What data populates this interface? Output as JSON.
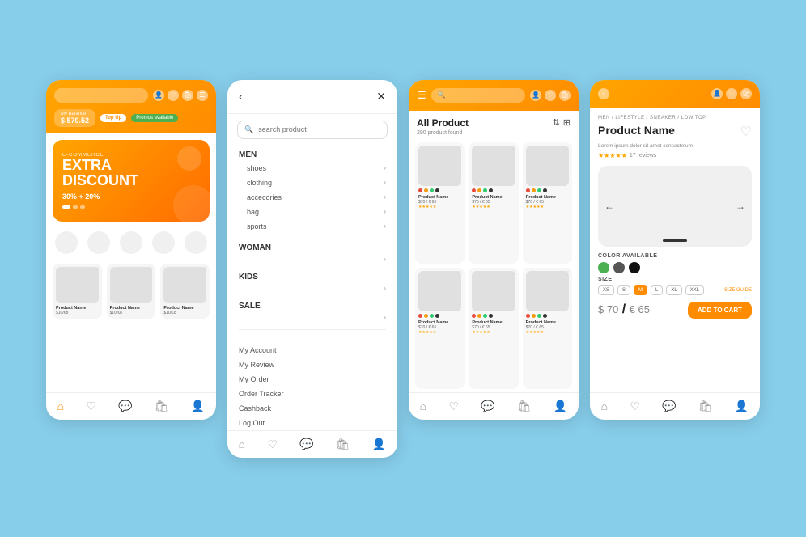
{
  "background": "#87CEEB",
  "screens": {
    "screen1": {
      "header": {
        "balance_label": "My Balance",
        "balance_amount": "$ 570.52",
        "top_up": "Top Up",
        "promo": "Promos available"
      },
      "banner": {
        "tag": "E-COMMERCE",
        "line1": "EXTRA",
        "line2": "DISCOUNT",
        "discount": "30% + 20%"
      },
      "products": [
        {
          "name": "Product Name",
          "price": "$10/€8"
        },
        {
          "name": "Product Name",
          "price": "$10/€8"
        },
        {
          "name": "Product Name",
          "price": "$10/€8"
        }
      ],
      "nav": [
        "🏠",
        "♡",
        "💬",
        "🛍",
        "👤"
      ]
    },
    "screen2": {
      "menu_sections": [
        {
          "title": "MEN",
          "items": [
            "shoes",
            "clothing",
            "accecories",
            "bag",
            "sports"
          ]
        },
        {
          "title": "WOMAN",
          "items": []
        },
        {
          "title": "KIDS",
          "items": []
        },
        {
          "title": "SALE",
          "items": []
        }
      ],
      "links": [
        "My Account",
        "My Review",
        "My Order",
        "Order Tracker",
        "Cashback",
        "Log Out"
      ],
      "search_placeholder": "search product"
    },
    "screen3": {
      "title": "All Product",
      "subtitle": "290 product found",
      "products": [
        {
          "name": "Product Name",
          "price": "$70 / € 65",
          "colors": [
            "#e74c3c",
            "#f39c12",
            "#2ecc71",
            "#333"
          ]
        },
        {
          "name": "Product Name",
          "price": "$70 / € 65",
          "colors": [
            "#e74c3c",
            "#f39c12",
            "#2ecc71",
            "#333"
          ]
        },
        {
          "name": "Product Name",
          "price": "$70 / € 65",
          "colors": [
            "#e74c3c",
            "#f39c12",
            "#2ecc71",
            "#333"
          ]
        },
        {
          "name": "Product Name",
          "price": "$70 / € 65",
          "colors": [
            "#e74c3c",
            "#f39c12",
            "#2ecc71",
            "#333"
          ]
        },
        {
          "name": "Product Name",
          "price": "$70 / € 65",
          "colors": [
            "#e74c3c",
            "#f39c12",
            "#2ecc71",
            "#333"
          ]
        },
        {
          "name": "Product Name",
          "price": "$70 / € 65",
          "colors": [
            "#e74c3c",
            "#f39c12",
            "#2ecc71",
            "#333"
          ]
        }
      ]
    },
    "screen4": {
      "breadcrumb": "MEN / LIFESTYLE / SNEAKER / LOW TOP",
      "title": "Product Name",
      "description": "Lorem ipsum dolor sit amet consectetum",
      "reviews": "17 reviews",
      "price": "$ 70",
      "price_eur": "€ 65",
      "add_cart": "ADD TO CART",
      "color_label": "COLOR AVAILABLE",
      "size_label": "SIZE",
      "sizes": [
        "XS",
        "S",
        "M",
        "L",
        "XL",
        "XXL"
      ],
      "active_size": "M",
      "size_guide": "SIZE GUIDE",
      "colors": [
        "#4CAF50",
        "#333",
        "#1a1a1a"
      ],
      "nav": [
        "←",
        "→"
      ]
    }
  }
}
